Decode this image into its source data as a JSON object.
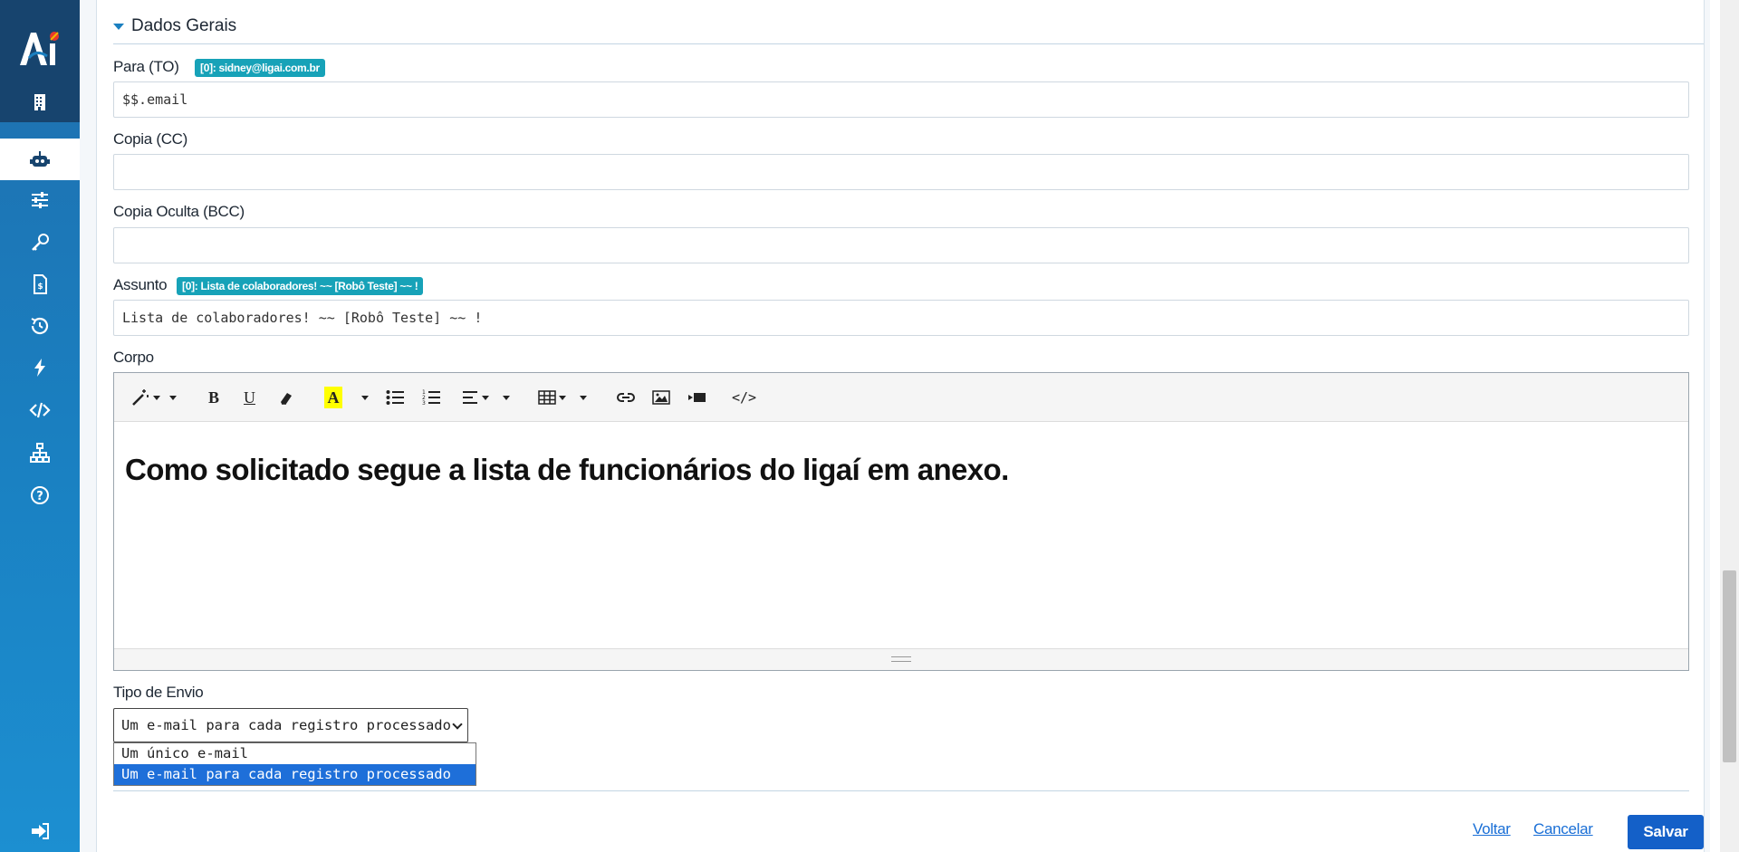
{
  "sidebar": {
    "logo_text": "Ai",
    "items": [
      {
        "icon": "building-icon",
        "name": "companies"
      },
      {
        "icon": "robot-icon",
        "name": "robots"
      },
      {
        "icon": "sliders-icon",
        "name": "settings"
      },
      {
        "icon": "key-icon",
        "name": "credentials"
      },
      {
        "icon": "invoice-icon",
        "name": "billing"
      },
      {
        "icon": "history-icon",
        "name": "history"
      },
      {
        "icon": "bolt-icon",
        "name": "triggers"
      },
      {
        "icon": "code-icon",
        "name": "code"
      },
      {
        "icon": "sitemap-icon",
        "name": "network"
      },
      {
        "icon": "help-icon",
        "name": "help"
      },
      {
        "icon": "logout-icon",
        "name": "logout"
      }
    ]
  },
  "section": {
    "title": "Dados Gerais"
  },
  "fields": {
    "to": {
      "label": "Para (TO)",
      "badge": "[0]: sidney@ligai.com.br",
      "value": "$$.email"
    },
    "cc": {
      "label": "Copia (CC)",
      "value": ""
    },
    "bcc": {
      "label": "Copia Oculta (BCC)",
      "value": ""
    },
    "subject": {
      "label": "Assunto",
      "badge": "[0]: Lista de colaboradores! ~~ [Robô Teste] ~~ !",
      "value": "Lista de colaboradores! ~~ [Robô Teste] ~~ !"
    },
    "body": {
      "label": "Corpo",
      "content": "Como solicitado segue a lista de funcionários do ligaí em anexo."
    }
  },
  "send_type": {
    "label": "Tipo de Envio",
    "selected": "Um e-mail para cada registro processado",
    "options": [
      "Um único e-mail",
      "Um e-mail para cada registro processado"
    ]
  },
  "actions": {
    "back": "Voltar",
    "cancel": "Cancelar",
    "save": "Salvar"
  },
  "colors": {
    "sidebar": "#1a7fc0",
    "badge": "#17a2b8",
    "primary": "#1460c8"
  }
}
